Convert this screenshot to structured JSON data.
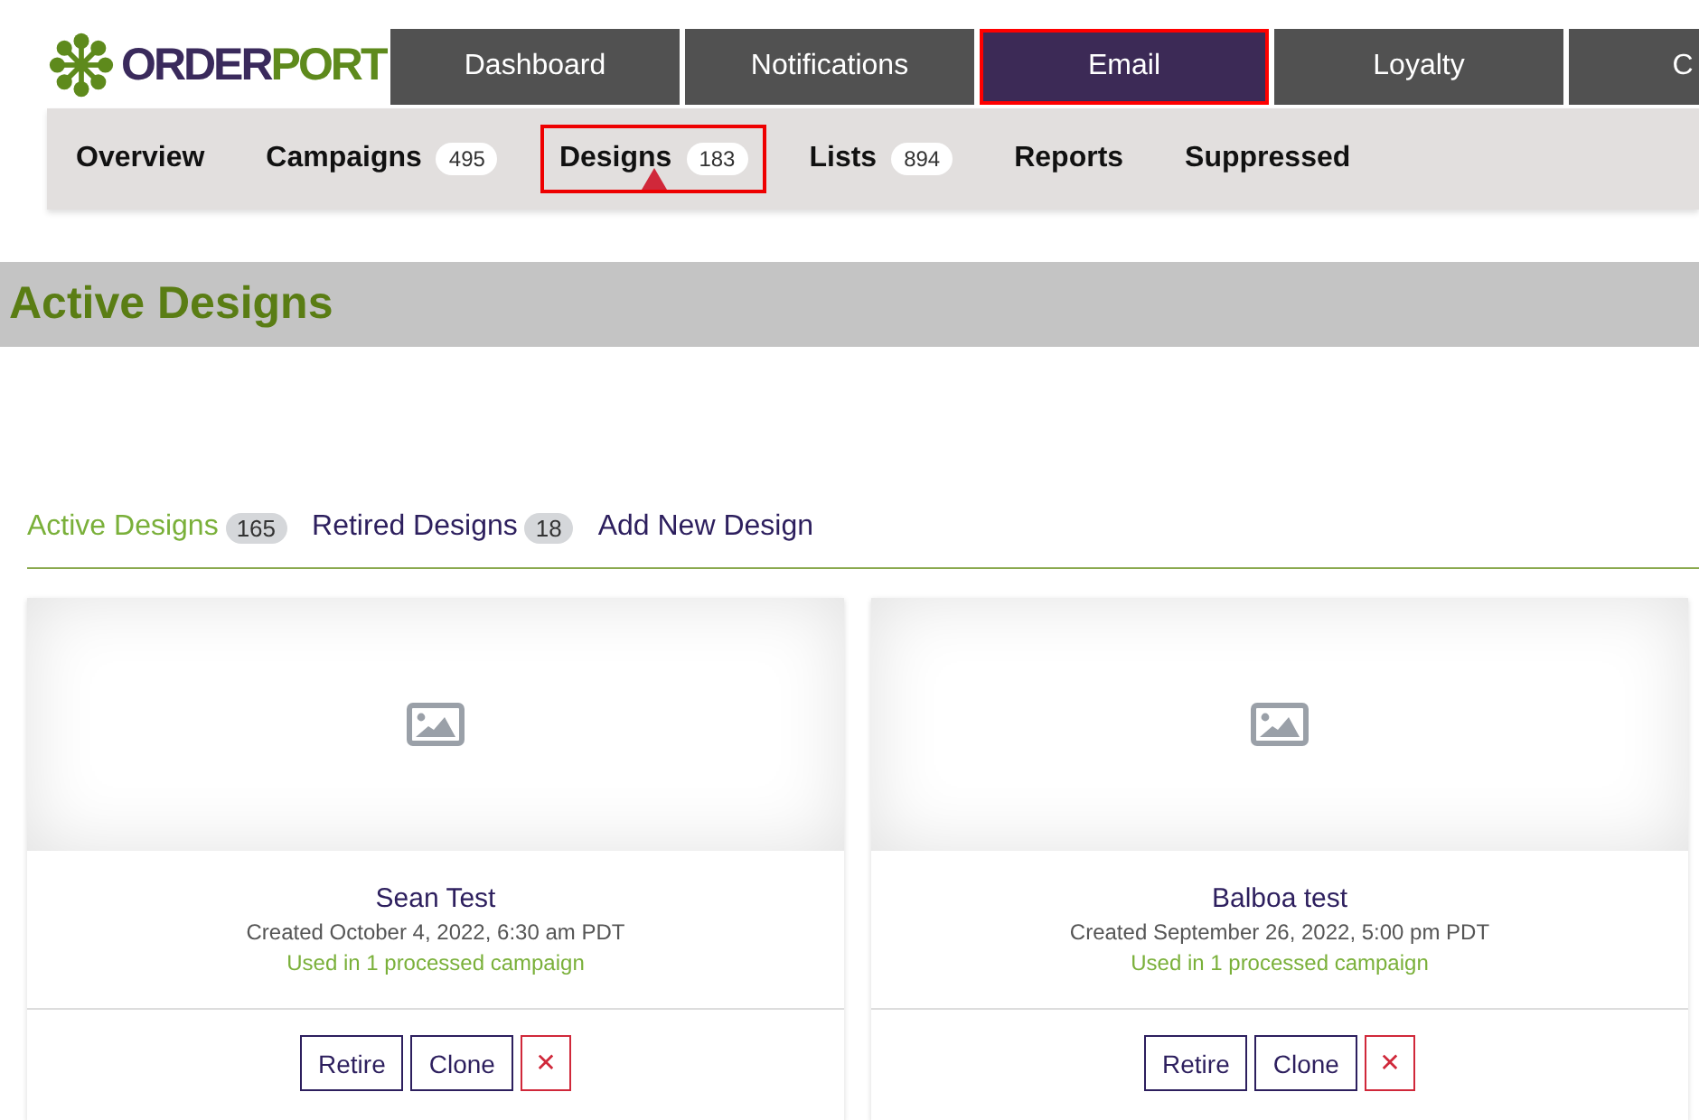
{
  "logo": {
    "parts": [
      "ORDER",
      "PORT"
    ]
  },
  "main_nav": [
    {
      "label": "Dashboard",
      "selected": false
    },
    {
      "label": "Notifications",
      "selected": false
    },
    {
      "label": "Email",
      "selected": true
    },
    {
      "label": "Loyalty",
      "selected": false
    },
    {
      "label": "C",
      "selected": false
    }
  ],
  "sub_nav": [
    {
      "label": "Overview",
      "selected": false
    },
    {
      "label": "Campaigns",
      "count": "495",
      "selected": false
    },
    {
      "label": "Designs",
      "count": "183",
      "selected": true
    },
    {
      "label": "Lists",
      "count": "894",
      "selected": false
    },
    {
      "label": "Reports",
      "selected": false
    },
    {
      "label": "Suppressed",
      "selected": false
    }
  ],
  "page_title": "Active Designs",
  "design_tabs": [
    {
      "label": "Active Designs",
      "count": "165",
      "selected": true
    },
    {
      "label": "Retired Designs",
      "count": "18",
      "selected": false
    },
    {
      "label": "Add New Design",
      "selected": false
    }
  ],
  "designs": [
    {
      "name": "Sean Test",
      "created": "Created October 4, 2022, 6:30 am PDT",
      "usage": "Used in 1 processed campaign",
      "buttons": [
        "Retire",
        "Clone"
      ],
      "delete": "✕"
    },
    {
      "name": "Balboa test",
      "created": "Created September 26, 2022, 5:00 pm PDT",
      "usage": "Used in 1 processed campaign",
      "buttons": [
        "Retire",
        "Clone"
      ],
      "delete": "✕"
    }
  ]
}
